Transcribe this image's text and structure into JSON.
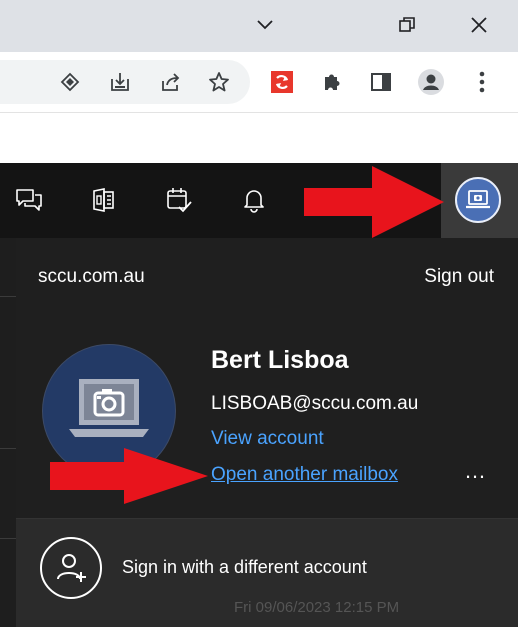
{
  "window": {
    "controls": {
      "chevron": "chevron-down-icon",
      "restore": "restore-icon",
      "close": "close-icon"
    }
  },
  "browser_toolbar": {
    "icons": [
      "diamond-icon",
      "install-icon",
      "share-icon",
      "bookmark-star-icon",
      "red-extension-icon",
      "puzzle-extensions-icon",
      "side-panel-icon",
      "profile-icon",
      "kebab-menu-icon"
    ]
  },
  "outlook_header": {
    "icons": [
      "chat-feedback-icon",
      "office-apps-icon",
      "calendar-check-icon",
      "bell-icon"
    ],
    "account_button_icon": "laptop-camera-icon"
  },
  "account_panel": {
    "domain": "sccu.com.au",
    "sign_out": "Sign out",
    "name": "Bert Lisboa",
    "email": "LISBOAB@sccu.com.au",
    "view_account": "View account",
    "open_another_mailbox": "Open another mailbox",
    "more_options": "…",
    "sign_in_different": "Sign in with a different account",
    "background_partial_text": "Fri 09/06/2023 12:15 PM"
  },
  "colors": {
    "header_bg": "#141414",
    "panel_bg": "#1f1f1f",
    "link": "#4aa3ff",
    "arrow": "#e8141c",
    "avatar_blue": "#4a6fb5"
  }
}
